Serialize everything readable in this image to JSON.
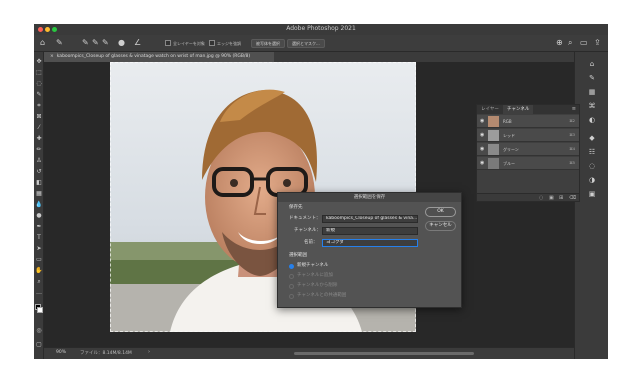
{
  "window": {
    "title": "Adobe Photoshop 2021"
  },
  "options_bar": {
    "sample_all_layers": "全レイヤーを対象",
    "auto_enhance": "エッジを強調",
    "select_subject": "被写体を選択",
    "select_and_mask": "選択とマスク..."
  },
  "document_tab": {
    "label": "kaboompics_Closeup of glasses & vinatage watch on wrist of man.jpg @ 90% (RGB/8)"
  },
  "channels_panel": {
    "tabs": [
      "レイヤー",
      "チャンネル"
    ],
    "channels": [
      {
        "name": "RGB",
        "shortcut": "⌘2"
      },
      {
        "name": "レッド",
        "shortcut": "⌘3"
      },
      {
        "name": "グリーン",
        "shortcut": "⌘4"
      },
      {
        "name": "ブルー",
        "shortcut": "⌘5"
      }
    ]
  },
  "dialog": {
    "title": "選択範囲を保存",
    "destination_heading": "保存先",
    "document_label": "ドキュメント：",
    "document_value": "kaboompics_Closeup of glasses & vina...",
    "channel_label": "チャンネル：",
    "channel_value": "新規",
    "name_label": "名前：",
    "name_value": "ヨコクダ",
    "operation_heading": "選択範囲",
    "operations": [
      {
        "label": "新規チャンネル",
        "selected": true,
        "enabled": true
      },
      {
        "label": "チャンネルに追加",
        "selected": false,
        "enabled": false
      },
      {
        "label": "チャンネルから削除",
        "selected": false,
        "enabled": false
      },
      {
        "label": "チャンネルとの共通範囲",
        "selected": false,
        "enabled": false
      }
    ],
    "ok_label": "OK",
    "cancel_label": "キャンセル"
  },
  "status": {
    "zoom": "90%",
    "file_info": "ファイル：8.14M/8.14M"
  },
  "colors": {
    "accent": "#2680eb",
    "workspace": "#535353",
    "panel": "#3b3b3b"
  }
}
